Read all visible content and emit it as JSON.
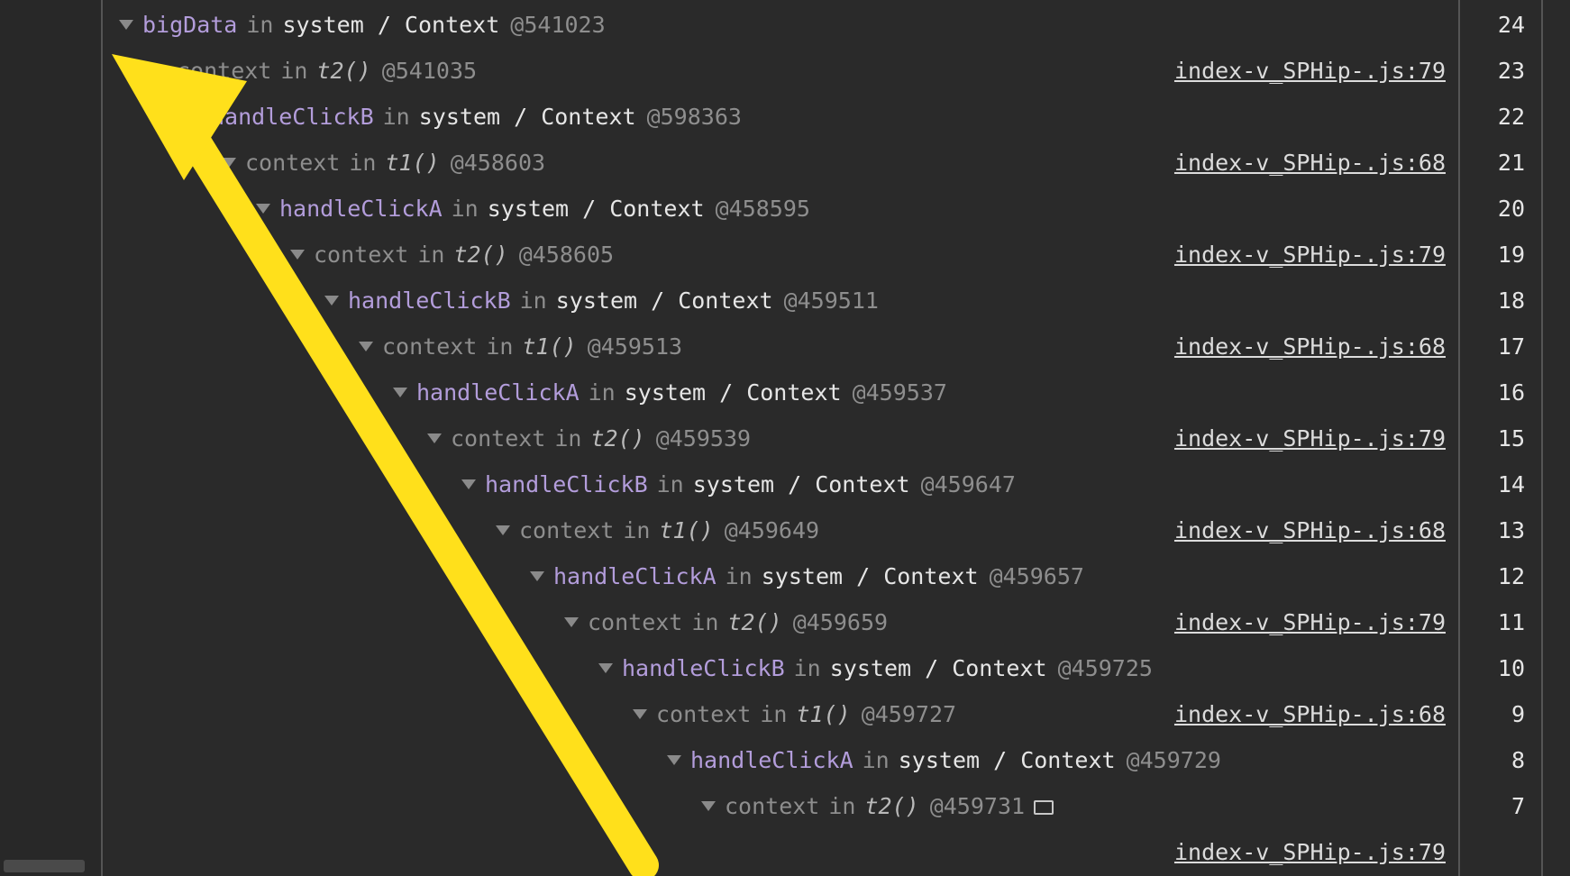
{
  "tree": [
    {
      "depth": 0,
      "name": "bigData",
      "kind": "prop",
      "inText": "in",
      "tail": "system / Context",
      "addr": "@541023",
      "source": "",
      "num": "24"
    },
    {
      "depth": 1,
      "name": "context",
      "kind": "gray",
      "inText": "in",
      "fn": "t2()",
      "addr": "@541035",
      "source": "index-v_SPHip-.js:79",
      "num": "23"
    },
    {
      "depth": 2,
      "name": "handleClickB",
      "kind": "prop",
      "inText": "in",
      "tail": "system / Context",
      "addr": "@598363",
      "source": "",
      "num": "22"
    },
    {
      "depth": 3,
      "name": "context",
      "kind": "gray",
      "inText": "in",
      "fn": "t1()",
      "addr": "@458603",
      "source": "index-v_SPHip-.js:68",
      "num": "21"
    },
    {
      "depth": 4,
      "name": "handleClickA",
      "kind": "prop",
      "inText": "in",
      "tail": "system / Context",
      "addr": "@458595",
      "source": "",
      "num": "20"
    },
    {
      "depth": 5,
      "name": "context",
      "kind": "gray",
      "inText": "in",
      "fn": "t2()",
      "addr": "@458605",
      "source": "index-v_SPHip-.js:79",
      "num": "19"
    },
    {
      "depth": 6,
      "name": "handleClickB",
      "kind": "prop",
      "inText": "in",
      "tail": "system / Context",
      "addr": "@459511",
      "source": "",
      "num": "18"
    },
    {
      "depth": 7,
      "name": "context",
      "kind": "gray",
      "inText": "in",
      "fn": "t1()",
      "addr": "@459513",
      "source": "index-v_SPHip-.js:68",
      "num": "17"
    },
    {
      "depth": 8,
      "name": "handleClickA",
      "kind": "prop",
      "inText": "in",
      "tail": "system / Context",
      "addr": "@459537",
      "source": "",
      "num": "16"
    },
    {
      "depth": 9,
      "name": "context",
      "kind": "gray",
      "inText": "in",
      "fn": "t2()",
      "addr": "@459539",
      "source": "index-v_SPHip-.js:79",
      "num": "15"
    },
    {
      "depth": 10,
      "name": "handleClickB",
      "kind": "prop",
      "inText": "in",
      "tail": "system / Context",
      "addr": "@459647",
      "source": "",
      "num": "14"
    },
    {
      "depth": 11,
      "name": "context",
      "kind": "gray",
      "inText": "in",
      "fn": "t1()",
      "addr": "@459649",
      "source": "index-v_SPHip-.js:68",
      "num": "13"
    },
    {
      "depth": 12,
      "name": "handleClickA",
      "kind": "prop",
      "inText": "in",
      "tail": "system / Context",
      "addr": "@459657",
      "source": "",
      "num": "12"
    },
    {
      "depth": 13,
      "name": "context",
      "kind": "gray",
      "inText": "in",
      "fn": "t2()",
      "addr": "@459659",
      "source": "index-v_SPHip-.js:79",
      "num": "11"
    },
    {
      "depth": 14,
      "name": "handleClickB",
      "kind": "prop",
      "inText": "in",
      "tail": "system / Context",
      "addr": "@459725",
      "source": "",
      "num": "10"
    },
    {
      "depth": 15,
      "name": "context",
      "kind": "gray",
      "inText": "in",
      "fn": "t1()",
      "addr": "@459727",
      "source": "index-v_SPHip-.js:68",
      "num": "9"
    },
    {
      "depth": 16,
      "name": "handleClickA",
      "kind": "prop",
      "inText": "in",
      "tail": "system / Context",
      "addr": "@459729",
      "source": "",
      "num": "8"
    },
    {
      "depth": 17,
      "name": "context",
      "kind": "gray",
      "inText": "in",
      "fn": "t2()",
      "addr": "@459731",
      "source": "",
      "hasBox": true,
      "num": "7"
    },
    {
      "depth": 0,
      "name": "",
      "kind": "spacer",
      "source": "index-v_SPHip-.js:79",
      "num": ""
    }
  ],
  "indentPx": 38,
  "colors": {
    "arrow": "#ffe01b"
  }
}
